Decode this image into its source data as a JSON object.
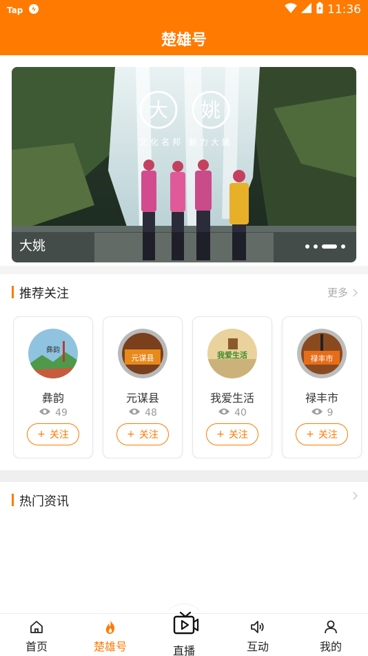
{
  "status_bar": {
    "carrier": "Tap",
    "time": "11:36"
  },
  "header": {
    "title": "楚雄号"
  },
  "banner": {
    "caption": "大姚",
    "overlay_title": "文化名邦 魅力大姚",
    "overlay_chars": [
      "大",
      "姚"
    ],
    "slide_count": 4,
    "active_slide": 2
  },
  "recommend": {
    "title": "推荐关注",
    "more_label": "更多",
    "follow_label": "关注",
    "items": [
      {
        "name": "彝韵",
        "views": "49",
        "avatar_text": "彝韵",
        "icon": "mountain-scene-avatar"
      },
      {
        "name": "元谋县",
        "views": "48",
        "avatar_text": "元谋县",
        "icon": "yuanmou-badge-avatar"
      },
      {
        "name": "我爱生活",
        "views": "40",
        "avatar_text": "我爱生活",
        "icon": "life-logo-avatar"
      },
      {
        "name": "禄丰市",
        "views": "9",
        "avatar_text": "禄丰市",
        "icon": "lufeng-badge-avatar"
      }
    ]
  },
  "news": {
    "title": "热门资讯"
  },
  "tabbar": {
    "items": [
      {
        "label": "首页",
        "icon": "home-icon"
      },
      {
        "label": "楚雄号",
        "icon": "flame-icon",
        "active": true
      },
      {
        "label": "直播",
        "icon": "tv-play-icon"
      },
      {
        "label": "互动",
        "icon": "speaker-icon"
      },
      {
        "label": "我的",
        "icon": "user-icon"
      }
    ]
  },
  "colors": {
    "accent": "#ff7a00",
    "text": "#222222",
    "muted": "#999999"
  }
}
